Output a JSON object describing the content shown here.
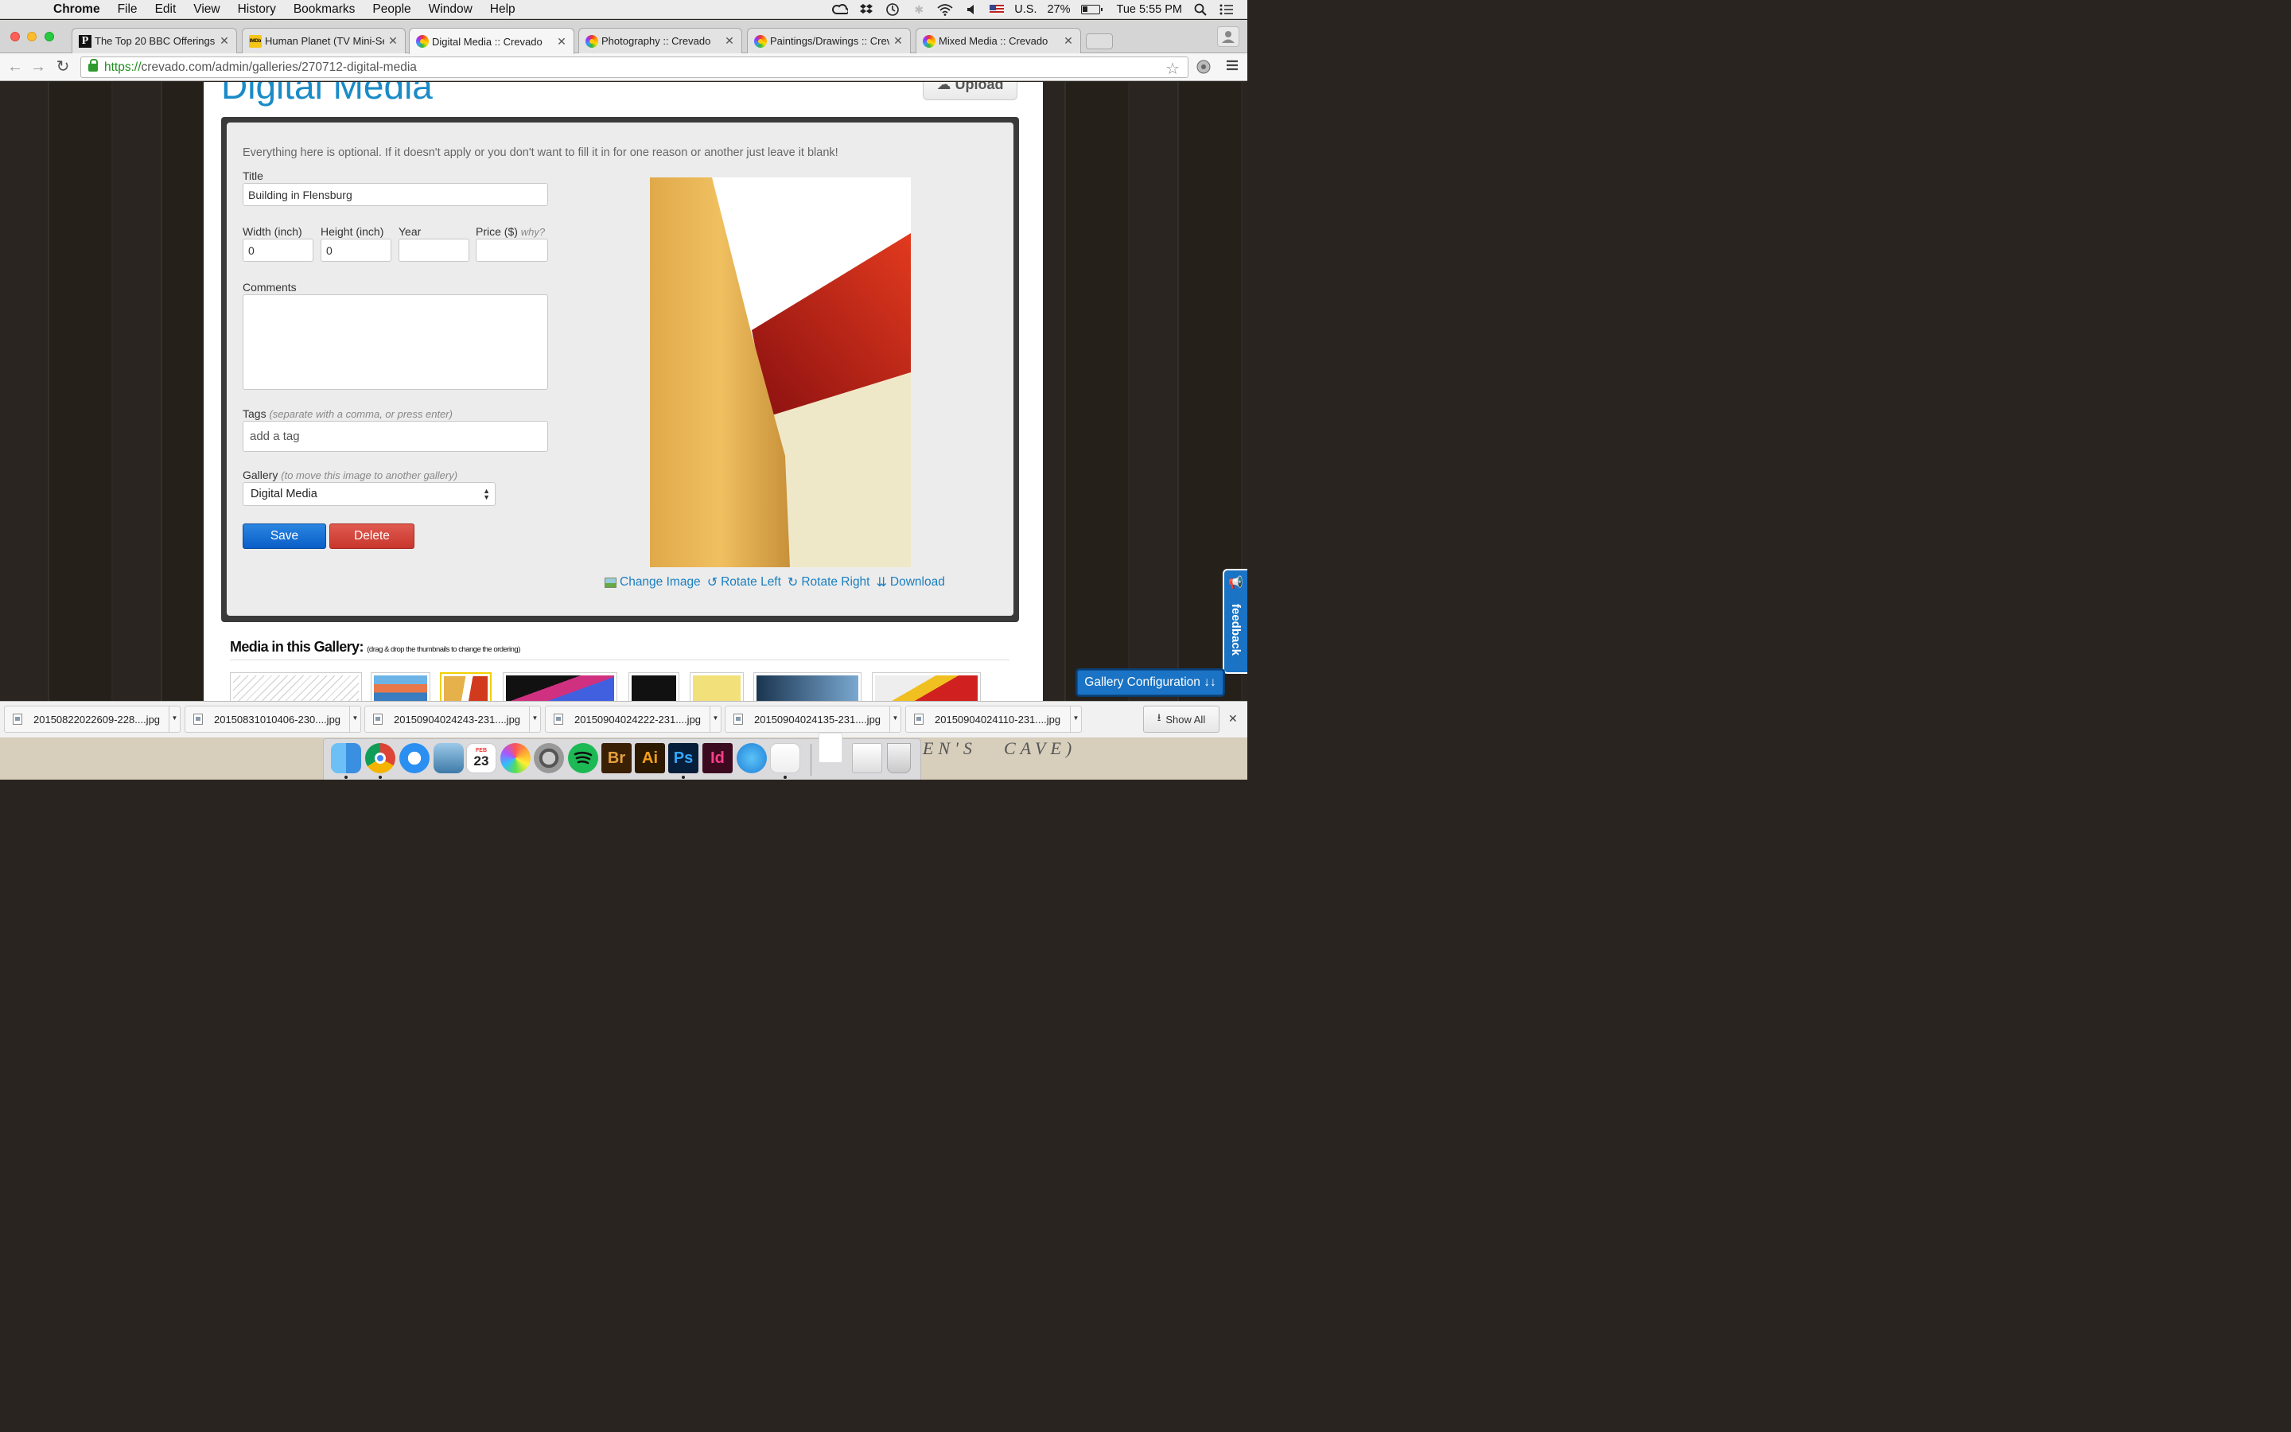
{
  "menubar": {
    "app": "Chrome",
    "items": [
      "File",
      "Edit",
      "View",
      "History",
      "Bookmarks",
      "People",
      "Window",
      "Help"
    ],
    "input_source": "U.S.",
    "battery": "27%",
    "clock": "Tue 5:55 PM"
  },
  "tabs": [
    {
      "title": "The Top 20 BBC Offerings",
      "favicon": "pbs-icon"
    },
    {
      "title": "Human Planet (TV Mini-Ser",
      "favicon": "imdb-icon"
    },
    {
      "title": "Digital Media :: Crevado",
      "favicon": "crevado-icon",
      "active": true
    },
    {
      "title": "Photography :: Crevado",
      "favicon": "crevado-icon"
    },
    {
      "title": "Paintings/Drawings :: Crev",
      "favicon": "crevado-icon"
    },
    {
      "title": "Mixed Media :: Crevado",
      "favicon": "crevado-icon"
    }
  ],
  "address": {
    "scheme": "https://",
    "rest": "crevado.com/admin/galleries/270712-digital-media"
  },
  "page": {
    "title": "Digital Media",
    "upload_label": "Upload"
  },
  "form": {
    "intro": "Everything here is optional. If it doesn't apply or you don't want to fill it in for one reason or another just leave it blank!",
    "title_label": "Title",
    "title_value": "Building in Flensburg",
    "width_label": "Width (inch)",
    "width_value": "0",
    "height_label": "Height (inch)",
    "height_value": "0",
    "year_label": "Year",
    "year_value": "",
    "price_label": "Price ($)",
    "price_hint": "why?",
    "price_value": "",
    "comments_label": "Comments",
    "comments_value": "",
    "tags_label": "Tags",
    "tags_hint": "(separate with a comma, or press enter)",
    "tags_placeholder": "add a tag",
    "gallery_label": "Gallery",
    "gallery_hint": "(to move this image to another gallery)",
    "gallery_selected": "Digital Media",
    "save_label": "Save",
    "delete_label": "Delete"
  },
  "image_actions": {
    "change": "Change Image",
    "rotate_left": "Rotate Left",
    "rotate_right": "Rotate Right",
    "download": "Download"
  },
  "media": {
    "heading": "Media in this Gallery:",
    "hint": "(drag & drop the thumbnails to change the ordering)"
  },
  "gallery_config_label": "Gallery Configuration ↓↓",
  "feedback_label": "feedback",
  "downloads": [
    "20150822022609-228....jpg",
    "20150831010406-230....jpg",
    "20150904024243-231....jpg",
    "20150904024222-231....jpg",
    "20150904024135-231....jpg",
    "20150904024110-231....jpg"
  ],
  "show_all_label": "Show All",
  "dock": {
    "calendar_month": "FEB",
    "calendar_day": "23",
    "apps": [
      "Br",
      "Ai",
      "Ps",
      "Id"
    ]
  },
  "desktop_text": [
    "EN'S",
    "CAVE)"
  ],
  "colors": {
    "accent": "#1a8bc7",
    "save": "#0a5ec8",
    "delete": "#c8362c",
    "link": "#1a7fc1"
  }
}
